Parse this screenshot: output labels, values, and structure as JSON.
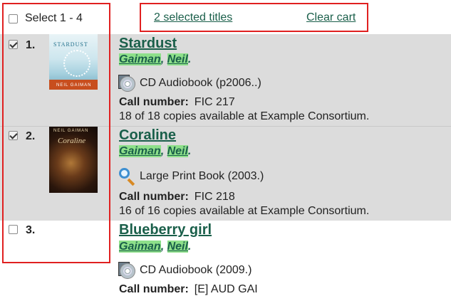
{
  "select_all": {
    "label": "Select 1 - 4"
  },
  "cart": {
    "selected_titles": "2 selected titles",
    "clear_cart": "Clear cart"
  },
  "results": [
    {
      "number": "1.",
      "checked": true,
      "title": "Stardust",
      "author_last": "Gaiman",
      "author_sep": ", ",
      "author_first": "Neil",
      "author_end": ".",
      "format_icon": "cd-audiobook-icon",
      "format": "CD Audiobook (p2006..)",
      "call_label": "Call number:",
      "call_number": "FIC 217",
      "availability": "18 of 18 copies available at Example Consortium.",
      "cover": {
        "title": "STARDUST",
        "author": "NEIL GAIMAN"
      }
    },
    {
      "number": "2.",
      "checked": true,
      "title": "Coraline",
      "author_last": "Gaiman",
      "author_sep": ", ",
      "author_first": "Neil",
      "author_end": ".",
      "format_icon": "large-print-icon",
      "format": "Large Print Book (2003.)",
      "call_label": "Call number:",
      "call_number": "FIC 218",
      "availability": "16 of 16 copies available at Example Consortium.",
      "cover": {
        "title": "Coraline",
        "author": "NEIL GAIMAN"
      }
    },
    {
      "number": "3.",
      "checked": false,
      "title": "Blueberry girl",
      "author_last": "Gaiman",
      "author_sep": ", ",
      "author_first": "Neil",
      "author_end": ".",
      "format_icon": "cd-audiobook-icon",
      "format": "CD Audiobook (2009.)",
      "call_label": "Call number:",
      "call_number": "[E] AUD GAI"
    }
  ],
  "colors": {
    "link": "#1a5f4a",
    "row_shade": "#dcdcdc",
    "author_highlight": "#8ee08a",
    "annotation_box": "#e02020"
  }
}
